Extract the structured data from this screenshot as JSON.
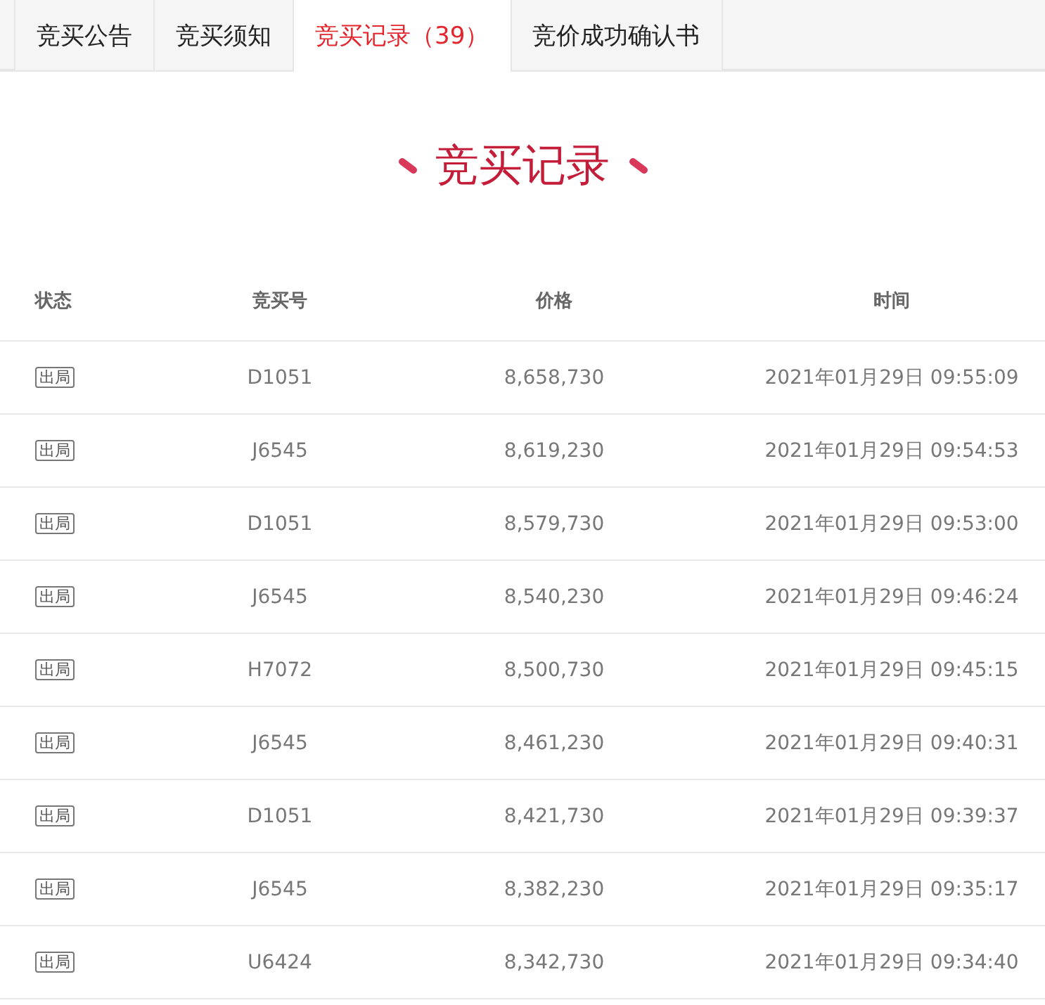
{
  "tabs": [
    {
      "label": "竞买公告",
      "selected": false
    },
    {
      "label": "竞买须知",
      "selected": false
    },
    {
      "label": "竞买记录（39）",
      "selected": true
    },
    {
      "label": "竞价成功确认书",
      "selected": false
    }
  ],
  "section_title": "竞买记录",
  "table": {
    "columns": [
      "状态",
      "竞买号",
      "价格",
      "时间"
    ],
    "rows": [
      {
        "status": "出局",
        "bidder": "D1051",
        "price": "8,658,730",
        "time": "2021年01月29日 09:55:09"
      },
      {
        "status": "出局",
        "bidder": "J6545",
        "price": "8,619,230",
        "time": "2021年01月29日 09:54:53"
      },
      {
        "status": "出局",
        "bidder": "D1051",
        "price": "8,579,730",
        "time": "2021年01月29日 09:53:00"
      },
      {
        "status": "出局",
        "bidder": "J6545",
        "price": "8,540,230",
        "time": "2021年01月29日 09:46:24"
      },
      {
        "status": "出局",
        "bidder": "H7072",
        "price": "8,500,730",
        "time": "2021年01月29日 09:45:15"
      },
      {
        "status": "出局",
        "bidder": "J6545",
        "price": "8,461,230",
        "time": "2021年01月29日 09:40:31"
      },
      {
        "status": "出局",
        "bidder": "D1051",
        "price": "8,421,730",
        "time": "2021年01月29日 09:39:37"
      },
      {
        "status": "出局",
        "bidder": "J6545",
        "price": "8,382,230",
        "time": "2021年01月29日 09:35:17"
      },
      {
        "status": "出局",
        "bidder": "U6424",
        "price": "8,342,730",
        "time": "2021年01月29日 09:34:40"
      }
    ]
  }
}
